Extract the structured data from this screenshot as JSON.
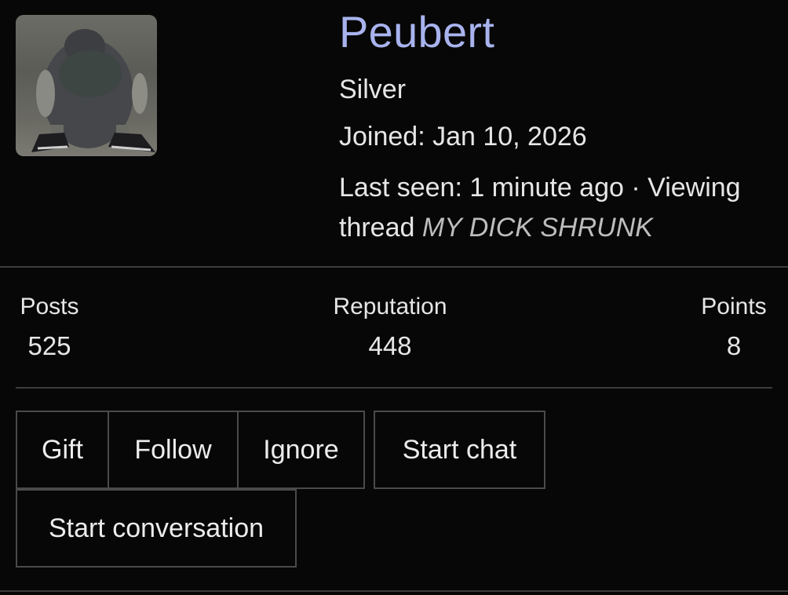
{
  "profile": {
    "username": "Peubert",
    "rank": "Silver",
    "joined": "Joined: Jan 10, 2026",
    "last_seen_prefix": "Last seen: 1 minute ago · Viewing thread ",
    "viewing_thread_title": "MY DICK SHRUNK",
    "avatar_icon": "pigeon-avatar-icon",
    "username_color": "#a8b3ee"
  },
  "stats": {
    "posts_label": "Posts",
    "posts_value": "525",
    "reputation_label": "Reputation",
    "reputation_value": "448",
    "points_label": "Points",
    "points_value": "8"
  },
  "actions": {
    "gift": "Gift",
    "follow": "Follow",
    "ignore": "Ignore",
    "start_chat": "Start chat",
    "start_conversation": "Start conversation"
  }
}
